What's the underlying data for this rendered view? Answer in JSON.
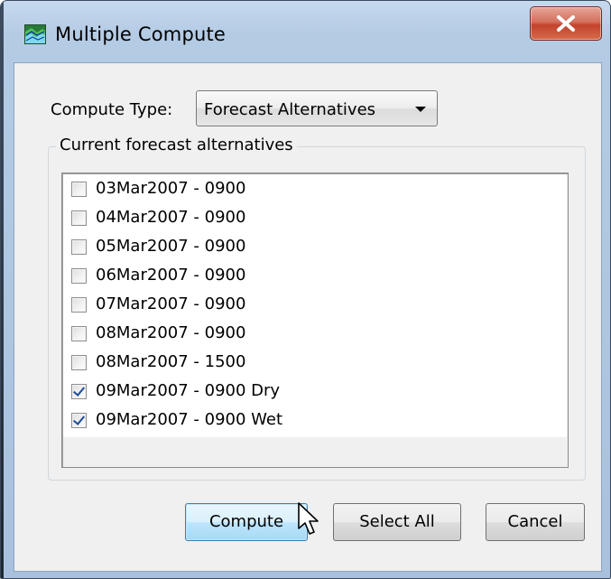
{
  "window": {
    "title": "Multiple Compute",
    "close_label": "X"
  },
  "compute_type": {
    "label": "Compute Type:",
    "selected": "Forecast Alternatives"
  },
  "group": {
    "title": "Current forecast alternatives"
  },
  "alternatives": [
    {
      "label": "03Mar2007 - 0900",
      "checked": false
    },
    {
      "label": "04Mar2007 - 0900",
      "checked": false
    },
    {
      "label": "05Mar2007 - 0900",
      "checked": false
    },
    {
      "label": "06Mar2007 - 0900",
      "checked": false
    },
    {
      "label": "07Mar2007 - 0900",
      "checked": false
    },
    {
      "label": "08Mar2007 - 0900",
      "checked": false
    },
    {
      "label": "08Mar2007 - 1500",
      "checked": false
    },
    {
      "label": "09Mar2007 - 0900 Dry",
      "checked": true
    },
    {
      "label": "09Mar2007 - 0900 Wet",
      "checked": true
    }
  ],
  "buttons": {
    "compute": "Compute",
    "select_all": "Select All",
    "cancel": "Cancel"
  },
  "icons": {
    "app": "landscape-chart-icon",
    "close": "close-icon",
    "dropdown": "chevron-down-icon",
    "cursor": "mouse-pointer-icon"
  },
  "colors": {
    "titlebar": "#b4cbe4",
    "close_button": "#c3432c",
    "default_button": "#bee6fd",
    "checkmark": "#1d4b9b"
  }
}
